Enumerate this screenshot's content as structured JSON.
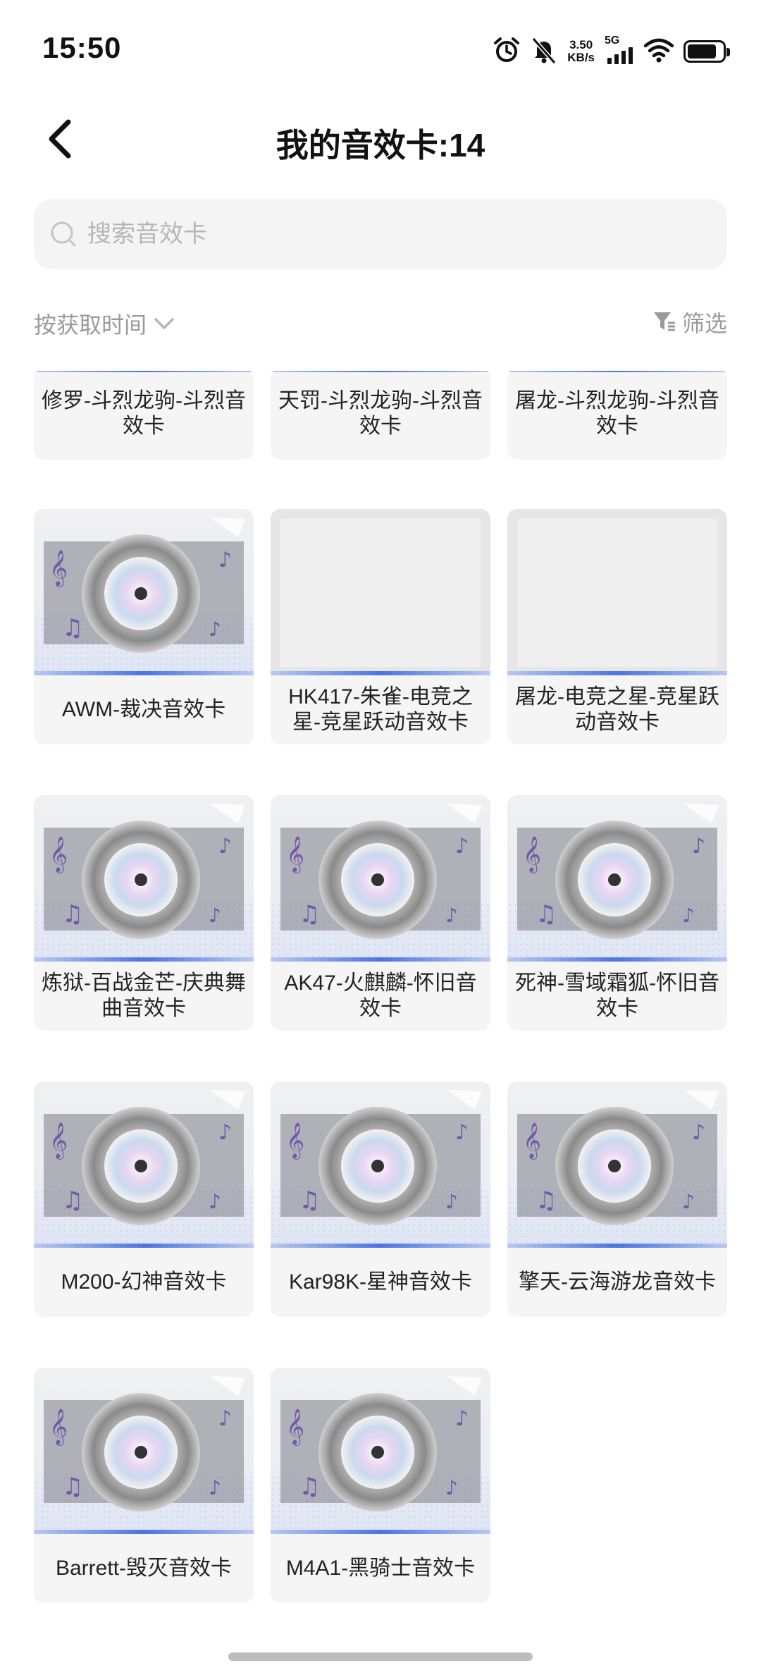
{
  "status": {
    "time": "15:50",
    "speed_value": "3.50",
    "speed_unit": "KB/s",
    "network": "5G",
    "icons": [
      "alarm-icon",
      "mute-bell-icon",
      "signal-icon",
      "wifi-icon",
      "battery-icon"
    ]
  },
  "header": {
    "back_icon": "chevron-left-icon",
    "title": "我的音效卡:14"
  },
  "search": {
    "placeholder": "搜索音效卡",
    "value": ""
  },
  "toolbar": {
    "sort_label": "按获取时间",
    "filter_label": "筛选"
  },
  "cards": [
    {
      "name": "修罗-斗烈龙驹-斗烈音效卡"
    },
    {
      "name": "天罚-斗烈龙驹-斗烈音效卡"
    },
    {
      "name": "屠龙-斗烈龙驹-斗烈音效卡"
    },
    {
      "name": "AWM-裁决音效卡"
    },
    {
      "name": "HK417-朱雀-电竞之星-竞星跃动音效卡"
    },
    {
      "name": "屠龙-电竞之星-竞星跃动音效卡"
    },
    {
      "name": "炼狱-百战金芒-庆典舞曲音效卡"
    },
    {
      "name": "AK47-火麒麟-怀旧音效卡"
    },
    {
      "name": "死神-雪域霜狐-怀旧音效卡"
    },
    {
      "name": "M200-幻神音效卡"
    },
    {
      "name": "Kar98K-星神音效卡"
    },
    {
      "name": "擎天-云海游龙音效卡"
    },
    {
      "name": "Barrett-毁灭音效卡"
    },
    {
      "name": "M4A1-黑骑士音效卡"
    }
  ],
  "colors": {
    "accent_line": "#4a74e0",
    "card_bg": "#f5f5f5",
    "search_bg": "#f4f4f4",
    "muted_text": "#9a9a9a"
  }
}
